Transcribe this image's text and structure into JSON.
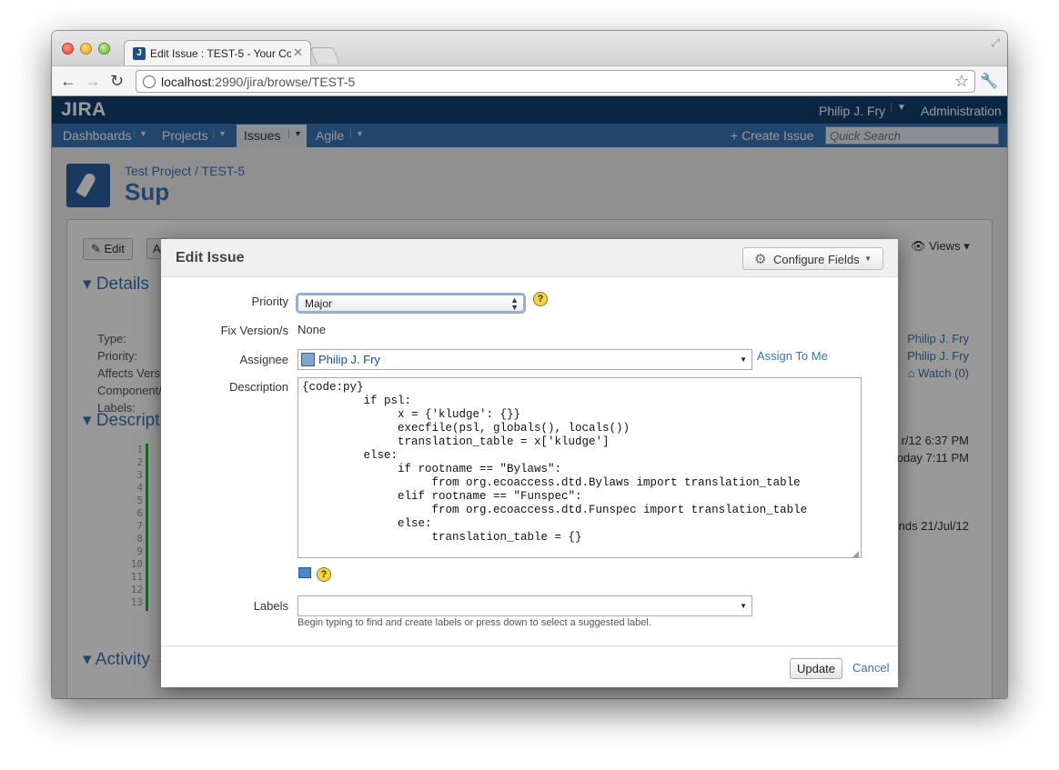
{
  "browser": {
    "tab_title": "Edit Issue : TEST-5 - Your Co",
    "favicon": "J",
    "url_host": "localhost",
    "url_path": ":2990/jira/browse/TEST-5"
  },
  "jira": {
    "logo": "JIRA",
    "user": "Philip J. Fry",
    "admin": "Administration",
    "nav": [
      "Dashboards",
      "Projects",
      "Issues",
      "Agile"
    ],
    "create_issue": "+ Create Issue",
    "quick_search_placeholder": "Quick Search",
    "breadcrumb": "Test Project / TEST-5",
    "title_fragment": "Sup",
    "edit_btn": "Edit",
    "a_btn": "A",
    "views": "Views",
    "details_heading": "Details",
    "details_labels": [
      "Type:",
      "Priority:",
      "Affects Vers",
      "Component/",
      "Labels:"
    ],
    "people": [
      "Philip J. Fry",
      "Philip J. Fry"
    ],
    "watch": "Watch (0)",
    "date1": "r/12 6:37 PM",
    "date2": "oday 7:11 PM",
    "date3": "nds 21/Jul/12",
    "description_heading": "Descript",
    "line_numbers": [
      "1",
      "2",
      "3",
      "4",
      "5",
      "6",
      "7",
      "8",
      "9",
      "10",
      "11",
      "12",
      "13"
    ],
    "activity_heading": "Activity"
  },
  "dialog": {
    "title": "Edit Issue",
    "configure_fields": "Configure Fields",
    "priority_label": "Priority",
    "priority_value": "Major",
    "fix_version_label": "Fix Version/s",
    "fix_version_value": "None",
    "assignee_label": "Assignee",
    "assignee_value": "Philip J. Fry",
    "assign_to_me": "Assign To Me",
    "description_label": "Description",
    "description_value": "{code:py}\n         if psl:\n              x = {'kludge': {}}\n              execfile(psl, globals(), locals())\n              translation_table = x['kludge']\n         else:\n              if rootname == \"Bylaws\":\n                   from org.ecoaccess.dtd.Bylaws import translation_table\n              elif rootname == \"Funspec\":\n                   from org.ecoaccess.dtd.Funspec import translation_table\n              else:\n                   translation_table = {}",
    "labels_label": "Labels",
    "labels_hint": "Begin typing to find and create labels or press down to select a suggested label.",
    "update": "Update",
    "cancel": "Cancel"
  },
  "colors": {
    "jira_header": "#114070",
    "jira_nav": "#3873b5",
    "link": "#3b73af"
  }
}
